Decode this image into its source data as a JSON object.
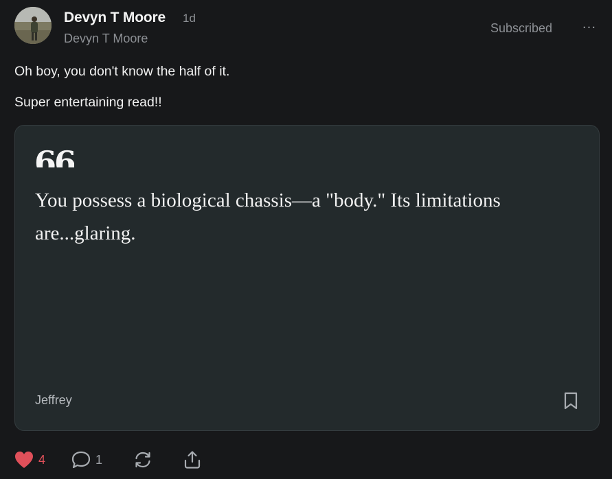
{
  "post": {
    "author_name": "Devyn T Moore",
    "timestamp": "1d",
    "author_handle": "Devyn T Moore",
    "subscribe_label": "Subscribed",
    "more_label": "···",
    "comment_lines": [
      "Oh boy, you don't know the half of it.",
      "Super entertaining read!!"
    ]
  },
  "quote": {
    "mark": "66",
    "text": "You possess a biological chassis—a \"body.\" Its limitations are...glaring.",
    "author": "Jeffrey"
  },
  "actions": {
    "like_count": "4",
    "comment_count": "1"
  },
  "colors": {
    "background": "#17181a",
    "card": "#232a2c",
    "like_red": "#e0505a",
    "muted": "#8c8f94"
  },
  "icons": [
    "avatar-photo",
    "more-icon",
    "bookmark-icon",
    "heart-icon",
    "comment-icon",
    "restack-icon",
    "share-icon"
  ]
}
